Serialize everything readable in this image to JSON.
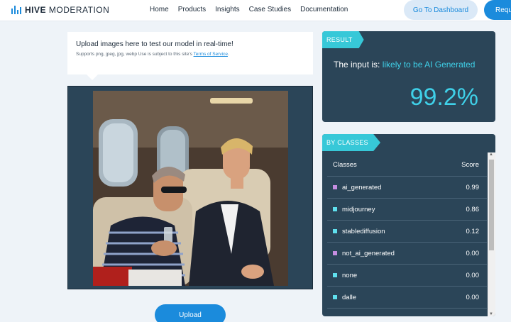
{
  "header": {
    "logo_bold": "HIVE",
    "logo_rest": "MODERATION",
    "nav": [
      "Home",
      "Products",
      "Insights",
      "Case Studies",
      "Documentation"
    ],
    "dashboard_label": "Go To Dashboard",
    "request_label": "Requ"
  },
  "upload": {
    "title": "Upload images here to test our model in real-time!",
    "subtitle": "Supports png, jpeg, jpg, webp Use is subject to this site's",
    "terms_link": "Terms of Service",
    "terms_suffix": ".",
    "button_label": "Upload"
  },
  "result": {
    "tab": "RESULT",
    "prefix": "The input is: ",
    "verdict": "likely to be AI Generated",
    "score": "99.2%"
  },
  "classes": {
    "tab": "BY CLASSES",
    "col_class": "Classes",
    "col_score": "Score",
    "rows": [
      {
        "name": "ai_generated",
        "score": "0.99",
        "color": "#c58de0"
      },
      {
        "name": "midjourney",
        "score": "0.86",
        "color": "#5fe0ee"
      },
      {
        "name": "stablediffusion",
        "score": "0.12",
        "color": "#5fe0ee"
      },
      {
        "name": "not_ai_generated",
        "score": "0.00",
        "color": "#c58de0"
      },
      {
        "name": "none",
        "score": "0.00",
        "color": "#5fe0ee"
      },
      {
        "name": "dalle",
        "score": "0.00",
        "color": "#5fe0ee"
      }
    ]
  },
  "colors": {
    "accent": "#1b8bdc",
    "panel": "#2b4558",
    "tab": "#37c8d8",
    "score_text": "#3fd0e8"
  }
}
